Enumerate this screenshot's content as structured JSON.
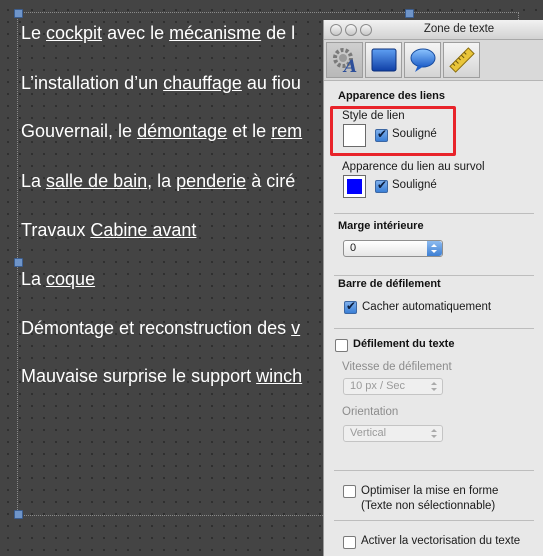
{
  "document": {
    "lines": [
      {
        "parts": [
          {
            "t": "Le "
          },
          {
            "t": "cockpit",
            "link": true
          },
          {
            "t": " avec le "
          },
          {
            "t": "mécanisme",
            "link": true
          },
          {
            "t": " de l"
          }
        ]
      },
      {
        "parts": [
          {
            "t": "L’installation d’un "
          },
          {
            "t": "chauffage",
            "link": true
          },
          {
            "t": " au fiou"
          }
        ]
      },
      {
        "parts": [
          {
            "t": "Gouvernail, le "
          },
          {
            "t": "démontage",
            "link": true
          },
          {
            "t": " et le "
          },
          {
            "t": "rem",
            "link": true
          }
        ]
      },
      {
        "parts": [
          {
            "t": "La "
          },
          {
            "t": "salle de bain",
            "link": true
          },
          {
            "t": ", la "
          },
          {
            "t": "penderie",
            "link": true
          },
          {
            "t": " à ciré"
          }
        ]
      },
      {
        "parts": [
          {
            "t": "Travaux "
          },
          {
            "t": "Cabine avant",
            "link": true
          }
        ]
      },
      {
        "parts": [
          {
            "t": "La "
          },
          {
            "t": "coque",
            "link": true
          }
        ]
      },
      {
        "parts": [
          {
            "t": "Démontage et reconstruction des "
          },
          {
            "t": "v",
            "link": true
          }
        ]
      },
      {
        "parts": [
          {
            "t": "Mauvaise surprise le support "
          },
          {
            "t": "winch",
            "link": true
          }
        ]
      }
    ]
  },
  "panel": {
    "title": "Zone de texte",
    "tabs": [
      {
        "icon": "gear-text-icon"
      },
      {
        "icon": "fill-square-icon"
      },
      {
        "icon": "speech-bubble-icon"
      },
      {
        "icon": "ruler-icon"
      }
    ],
    "links_appearance": {
      "heading": "Apparence des liens",
      "link_style_label": "Style de lien",
      "link_color": "#ffffff",
      "link_underline_label": "Souligné",
      "link_underline_checked": true,
      "hover_label": "Apparence du lien au survol",
      "hover_color": "#0000ff",
      "hover_underline_label": "Souligné",
      "hover_underline_checked": true
    },
    "inner_margin": {
      "heading": "Marge intérieure",
      "value": "0"
    },
    "scrollbar": {
      "heading": "Barre de défilement",
      "auto_hide_label": "Cacher automatiquement",
      "auto_hide_checked": true
    },
    "text_scroll": {
      "heading": "Défilement du texte",
      "checked": false,
      "speed_label": "Vitesse de défilement",
      "speed_value": "10 px / Sec",
      "orientation_label": "Orientation",
      "orientation_value": "Vertical"
    },
    "optimize": {
      "label_line1": "Optimiser la mise en forme",
      "label_line2": "(Texte non sélectionnable)",
      "checked": false
    },
    "vectorize": {
      "label": "Activer la vectorisation du texte",
      "checked": false
    }
  },
  "colors": {
    "highlight": "#e8232a",
    "canvas_bg": "#444444"
  }
}
